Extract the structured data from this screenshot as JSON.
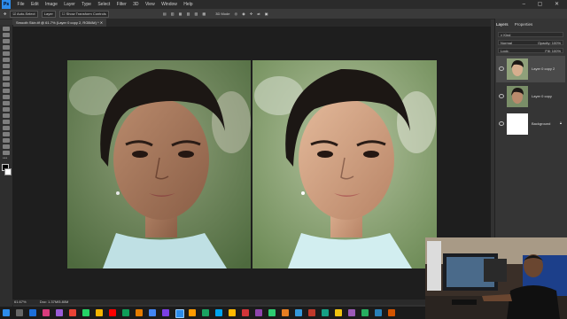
{
  "menu": {
    "items": [
      "File",
      "Edit",
      "Image",
      "Layer",
      "Type",
      "Select",
      "Filter",
      "3D",
      "View",
      "Window",
      "Help"
    ],
    "window_controls": "– ▢ ✕"
  },
  "options_bar": {
    "auto_select": "Auto-Select",
    "layer_select": "Layer",
    "show_transform": "Show Transform Controls",
    "mode_3d": "3D Mode"
  },
  "document": {
    "tab_title": "Smooth Skin.tif @ 61.7% (Layer 0 copy 2, RGB/8#) *",
    "zoom": "61.67%",
    "doc_size": "Doc: 1.37M/5.80M"
  },
  "panel": {
    "tabs": [
      "Layers",
      "Properties"
    ],
    "kind": "Kind",
    "blend_mode": "Normal",
    "opacity_label": "Opacity:",
    "opacity_value": "100%",
    "lock_label": "Lock:",
    "fill_label": "Fill:",
    "fill_value": "100%",
    "layers": [
      "Layer 0 copy 2",
      "Layer 0 copy",
      "Background"
    ]
  },
  "colors": {
    "accent": "#2d8ceb",
    "canvas_bg": "#1e1e1e"
  }
}
